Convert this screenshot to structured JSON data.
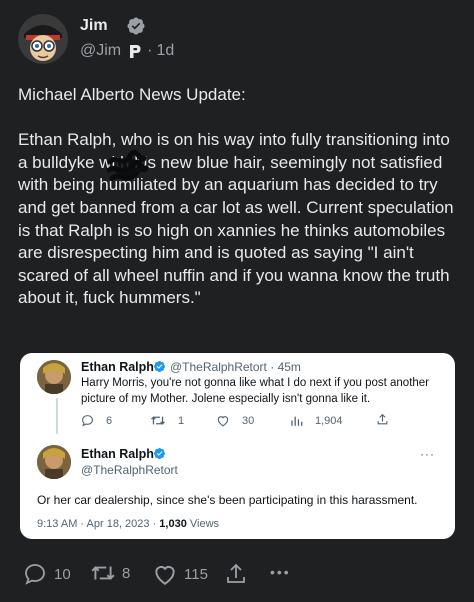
{
  "author": {
    "name": "Jim",
    "handle": "@Jim",
    "separator": "·",
    "time": "1d"
  },
  "post": {
    "text": "Michael Alberto News Update:\n\nEthan Ralph, who is on his way into fully transitioning into a bulldyke with his new blue hair, seemingly not satisfied with being humiliated by an aquarium has decided to try and get banned from a car lot as well. Current speculation is that Ralph is so high on xannies he thinks automobiles are disrespecting him and is quoted as saying \"I ain't scared of all wheel nuffin and if you wanna know the truth about it, fuck hummers.\""
  },
  "quote": {
    "first": {
      "name": "Ethan Ralph",
      "handle": "@TheRalphRetort",
      "separator": "·",
      "time": "45m",
      "text": "Harry Morris, you're not gonna like what I do next if you post another picture of my Mother. Jolene especially isn't gonna like it.",
      "replies": "6",
      "retweets": "1",
      "likes": "30",
      "views": "1,904"
    },
    "second": {
      "name": "Ethan Ralph",
      "handle": "@TheRalphRetort",
      "more": "···",
      "text": "Or her car dealership, since she's been participating in this harassment.",
      "timestamp": "9:13 AM · Apr 18, 2023 · ",
      "views_count": "1,030",
      "views_label": " Views"
    }
  },
  "actions": {
    "replies": "10",
    "reposts": "8",
    "likes": "115",
    "more": "•••"
  },
  "colors": {
    "background": "#1e2022",
    "verified": "#1d9bf0",
    "muted": "#9aa0a6"
  }
}
